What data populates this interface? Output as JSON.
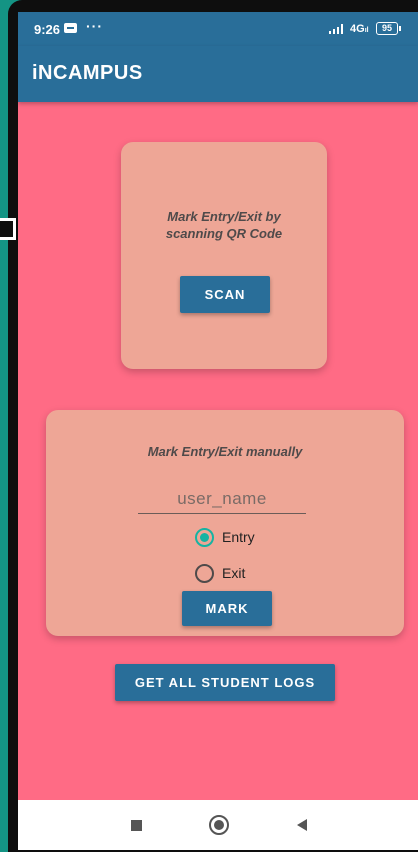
{
  "status_bar": {
    "time": "9:26",
    "overflow_dots": "···",
    "network": "4G",
    "network_sub": "ıl",
    "battery": "95",
    "icons": [
      "message-icon",
      "signal-icon",
      "battery-icon"
    ]
  },
  "app_bar": {
    "title": "iNCAMPUS"
  },
  "scan_card": {
    "caption": "Mark Entry/Exit by scanning QR Code",
    "button_label": "SCAN"
  },
  "manual_card": {
    "caption": "Mark Entry/Exit manually",
    "username_placeholder": "user_name",
    "username_value": "",
    "radio_options": [
      {
        "label": "Entry",
        "checked": true
      },
      {
        "label": "Exit",
        "checked": false
      }
    ],
    "button_label": "MARK"
  },
  "logs_button_label": "GET ALL STUDENT LOGS",
  "nav_bar": {
    "icons": [
      "recents-square-icon",
      "home-circle-icon",
      "back-triangle-icon"
    ]
  },
  "colors": {
    "primary": "#296e99",
    "background": "#ff6b85",
    "card": "#eea696",
    "accent": "#16b3a2",
    "frame": "#1a9e8e"
  }
}
